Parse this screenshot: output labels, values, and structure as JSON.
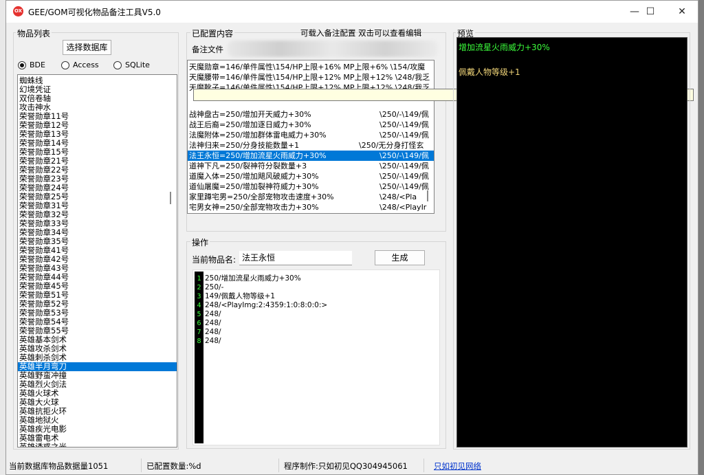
{
  "window": {
    "title": "GEE/GOM可视化物品备注工具V5.0",
    "icon_label": "OX",
    "minimize_glyph": "—",
    "maximize_glyph": "☐",
    "close_glyph": "✕"
  },
  "item_list_group": {
    "title": "物品列表",
    "select_db_label": "选择数据库",
    "db_types": [
      {
        "label": "BDE",
        "checked": true
      },
      {
        "label": "Access",
        "checked": false
      },
      {
        "label": "SQLite",
        "checked": false
      }
    ],
    "items": [
      "蜘蛛线",
      "幻境凭证",
      "双倍卷轴",
      "攻击神水",
      "荣誉勋章11号",
      "荣誉勋章12号",
      "荣誉勋章13号",
      "荣誉勋章14号",
      "荣誉勋章15号",
      "荣誉勋章21号",
      "荣誉勋章22号",
      "荣誉勋章23号",
      "荣誉勋章24号",
      "荣誉勋章25号",
      "荣誉勋章31号",
      "荣誉勋章32号",
      "荣誉勋章33号",
      "荣誉勋章34号",
      "荣誉勋章35号",
      "荣誉勋章41号",
      "荣誉勋章42号",
      "荣誉勋章43号",
      "荣誉勋章44号",
      "荣誉勋章45号",
      "荣誉勋章51号",
      "荣誉勋章52号",
      "荣誉勋章53号",
      "荣誉勋章54号",
      "荣誉勋章55号",
      "英雄基本剑术",
      "英雄攻杀剑术",
      "英雄刺杀剑术",
      "英雄半月弯刀",
      "英雄野蛮冲撞",
      "英雄烈火剑法",
      "英雄火球术",
      "英雄大火球",
      "英雄抗拒火环",
      "英雄地狱火",
      "英雄疾光电影",
      "英雄雷电术",
      "英雄诱惑之光"
    ],
    "selected_index": 32
  },
  "configured_group": {
    "title": "已配置内容",
    "hint": "可载入备注配置 双击可以查看编辑",
    "file_label": "备注文件",
    "items": [
      {
        "left": "天魔勋章=146/单件属性\\154/HP上限+16% MP上限+6% \\154/攻魔",
        "right": ""
      },
      {
        "left": "天魔腰带=146/单件属性\\154/HP上限+12% MP上限+12% \\248/我乏",
        "right": ""
      },
      {
        "left": "天魔靴子=146/单件属性\\154/HP上限+12% MP上限+12% \\248/我乏",
        "right": ""
      },
      {
        "left": "战神盘古=250/增加开天威力+30%",
        "right": "\\250/-\\149/佩"
      },
      {
        "left": "战王后裔=250/增加逐日威力+30%",
        "right": "\\250/-\\149/佩"
      },
      {
        "left": "法魔附体=250/增加群体雷电威力+30%",
        "right": "\\250/-\\149/佩"
      },
      {
        "left": "法神归来=250/分身技能数量+1",
        "right": "\\250/无分身打怪玄"
      },
      {
        "left": "法王永恒=250/增加流星火雨威力+30%",
        "right": "\\250/-\\149/佩"
      },
      {
        "left": "道神下凡=250/裂神符分裂数量+3",
        "right": "\\250/-\\149/佩"
      },
      {
        "left": "道魔入体=250/增加飓风破威力+30%",
        "right": "\\250/-\\149/佩"
      },
      {
        "left": "道仙屠魔=250/增加裂神符威力+30%",
        "right": "\\250/-\\149/佩"
      },
      {
        "left": "家里蹲宅男=250/全部宠物攻击速度+30%",
        "right": "\\248/<Pla"
      },
      {
        "left": "宅男女神=250/全部宠物攻击力+30%",
        "right": "\\248/<PlayIr"
      }
    ],
    "selected_index": 7
  },
  "operation_group": {
    "title": "操作",
    "current_item_label": "当前物品名:",
    "current_item_value": "法王永恒",
    "generate_label": "生成",
    "lines": [
      {
        "n": "1",
        "text": "250/增加流星火雨威力+30%"
      },
      {
        "n": "2",
        "text": "250/-"
      },
      {
        "n": "3",
        "text": "149/佩戴人物等级+1"
      },
      {
        "n": "4",
        "text": "248/<PlayImg:2:4359:1:0:8:0:0:>"
      },
      {
        "n": "5",
        "text": "248/"
      },
      {
        "n": "6",
        "text": "248/"
      },
      {
        "n": "7",
        "text": "248/"
      },
      {
        "n": "8",
        "text": "248/"
      }
    ]
  },
  "preview_group": {
    "title": "预览",
    "line1": "增加流星火雨威力+30%",
    "line1_color": "#3cff3c",
    "line2": "佩戴人物等级+1",
    "line2_color": "#f0d478"
  },
  "status": {
    "db_count": "当前数据库物品数据量1051",
    "configured_count": "已配置数量:%d",
    "author": "程序制作:只如初见QQ304945061",
    "link": "只如初见网络"
  }
}
